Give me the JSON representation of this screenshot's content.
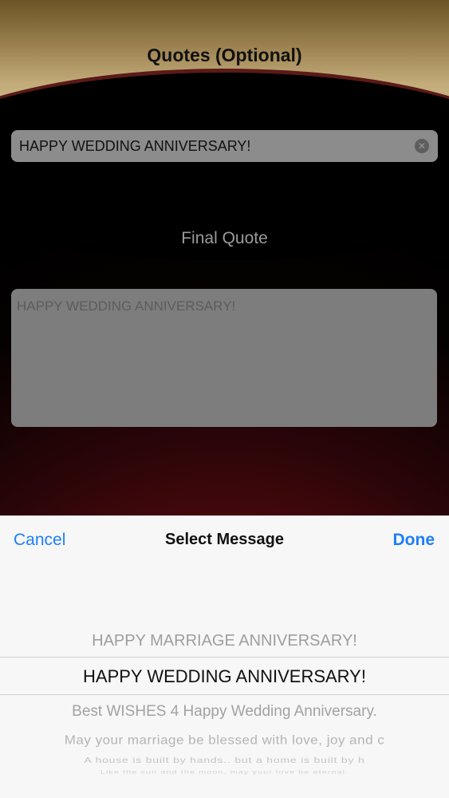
{
  "header": {
    "title": "Quotes (Optional)"
  },
  "quote_input": {
    "value": "HAPPY WEDDING ANNIVERSARY!"
  },
  "final_quote": {
    "label": "Final Quote",
    "value": "HAPPY WEDDING ANNIVERSARY!"
  },
  "picker": {
    "cancel_label": "Cancel",
    "title": "Select Message",
    "done_label": "Done",
    "options": [
      "HAPPY MARRIAGE ANNIVERSARY!",
      "HAPPY WEDDING ANNIVERSARY!",
      "Best WISHES 4 Happy Wedding Anniversary.",
      "May your marriage be blessed with love, joy and c",
      "A house is built by hands.. but a home is built by h",
      "Like the sun and the moon, may your love be eternal."
    ],
    "selected_index": 1
  },
  "colors": {
    "accent": "#1e7ff6",
    "header_gold": "#c2ab79",
    "background_red": "#8a1418"
  }
}
